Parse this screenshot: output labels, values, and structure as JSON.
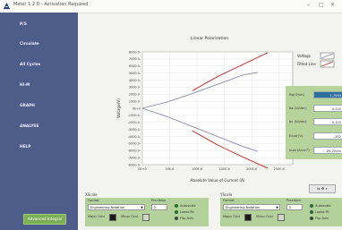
{
  "window": {
    "title": "Meter 1.2 D - Activation Required"
  },
  "sidebar": {
    "items": [
      {
        "label": "P/S"
      },
      {
        "label": "Circulate"
      },
      {
        "label": "All Cycles"
      },
      {
        "label": "HI-M"
      },
      {
        "label": "GRAPH"
      },
      {
        "label": "ANALYSE"
      },
      {
        "label": "HELP"
      }
    ],
    "advanced_button": "Advanced Integral"
  },
  "chart_data": {
    "type": "line",
    "title": "Linear Polarization",
    "xlabel": "Absolute Value of Current (A)",
    "ylabel": "Voltage(V)",
    "xlim": [
      0,
      0.0003
    ],
    "ylim": [
      -0.008,
      0.008
    ],
    "x_ticks": [
      "0E+0",
      "50E-6",
      "100E-6",
      "150E-6",
      "200E-6",
      "250E-6"
    ],
    "y_ticks": [
      "8000.0-",
      "7000.0-",
      "6000.0-",
      "5000.0-",
      "4000.0-",
      "3000.0-",
      "2000.0-",
      "1000.0-",
      "0E+0",
      "-1000.0-",
      "-2000.0-",
      "-3000.0-",
      "-4000.0-",
      "-5000.0-",
      "-6000.0-",
      "-7000.0-",
      "-8000.0-"
    ],
    "grid": true,
    "legend": {
      "position": "top-right"
    },
    "series": [
      {
        "name": "Voltage",
        "color": "#8a8aaa",
        "x": [
          0,
          5e-05,
          0.0001,
          0.00015,
          0.0002,
          0.00023
        ],
        "y": [
          0,
          0.0009,
          0.0021,
          0.0034,
          0.0047,
          0.0051
        ]
      },
      {
        "name": "Voltage",
        "color": "#8a8aaa",
        "x": [
          0,
          5e-05,
          0.0001,
          0.00015,
          0.0002,
          0.00023
        ],
        "y": [
          0,
          -0.0012,
          -0.0026,
          -0.004,
          -0.0054,
          -0.0061
        ]
      },
      {
        "name": "Fitted Line",
        "color": "#cc2a2a",
        "x": [
          0.0001,
          0.00015,
          0.0002,
          0.00025
        ],
        "y": [
          0.0025,
          0.0045,
          0.0062,
          0.0079
        ]
      },
      {
        "name": "Fitted Line",
        "color": "#cc2a2a",
        "x": [
          0.0001,
          0.00015,
          0.0002,
          0.00025
        ],
        "y": [
          -0.0032,
          -0.0052,
          -0.0069,
          -0.0085
        ]
      }
    ]
  },
  "results": [
    {
      "label": "Rp(Ohm)",
      "value": "1.7594",
      "accent": "#2f6fa0"
    },
    {
      "label": "ba (V/dec)",
      "value": "0.120"
    },
    {
      "label": "bc (V/dec)",
      "value": "0.120"
    },
    {
      "label": "Ecorr(V)",
      "value": "-.352"
    },
    {
      "label": "Icorr(A/cm²)",
      "value": "28.720m"
    }
  ],
  "graph_tools": "⇆ ✥ ⌕",
  "xscale": {
    "title": "XScale",
    "format_label": "Format",
    "format_value": "Engineering Notation",
    "precision_label": "Precision",
    "precision_value": "2",
    "major_grid": "Major Grid",
    "minor_grid": "Minor Grid",
    "options": [
      "Autoscale",
      "Loose Fit",
      "Flip Axis"
    ]
  },
  "yscale": {
    "title": "YScale",
    "format_label": "Format",
    "format_value": "Engineering Notation",
    "precision_label": "Precision",
    "precision_value": "2",
    "major_grid": "Major Grid",
    "minor_grid": "Minor Grid",
    "options": [
      "Autoscale",
      "Loose Fit",
      "Flip Axis"
    ]
  }
}
